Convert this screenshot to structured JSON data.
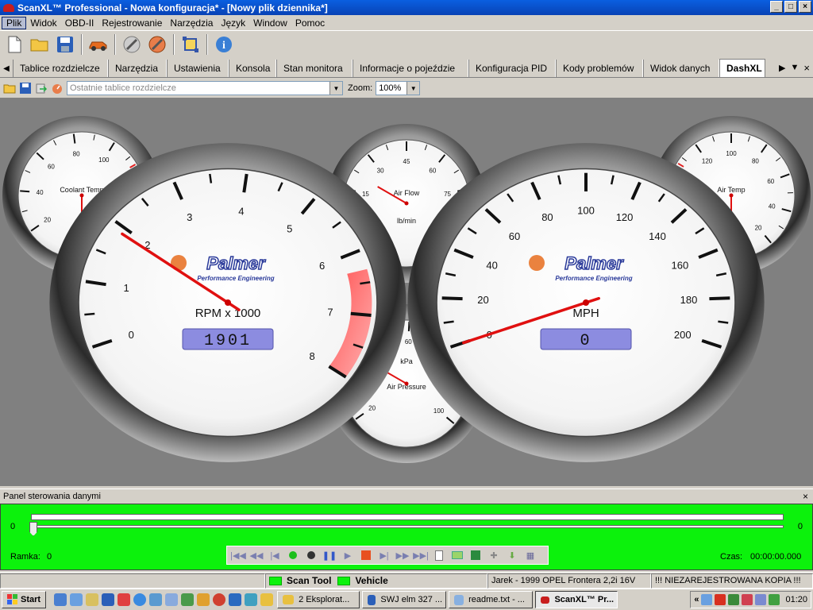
{
  "window": {
    "title": "ScanXL™ Professional - Nowa konfiguracja* - [Nowy plik dziennika*]",
    "minimize": "_",
    "maximize": "□",
    "close": "×"
  },
  "menu": [
    "Plik",
    "Widok",
    "OBD-II",
    "Rejestrowanie",
    "Narzędzia",
    "Język",
    "Window",
    "Pomoc"
  ],
  "tabs": {
    "items": [
      "Tablice rozdzielcze",
      "Narzędzia",
      "Ustawienia",
      "Konsola",
      "Stan monitora",
      "Informacje o pojeździe",
      "Konfiguracja PID",
      "Kody problemów",
      "Widok danych",
      "DashXL"
    ],
    "active_index": 9
  },
  "subtoolbar": {
    "recent_dash_placeholder": "Ostatnie tablice rozdzielcze",
    "zoom_label": "Zoom:",
    "zoom_value": "100%"
  },
  "gauges": {
    "coolant": {
      "label": "Coolant Temp",
      "unit": "°C",
      "ticks": [
        "20",
        "40",
        "60",
        "80",
        "100",
        "120",
        "140"
      ]
    },
    "airflow": {
      "label": "Air Flow",
      "unit": "lb/min",
      "ticks": [
        "0",
        "15",
        "30",
        "45",
        "60",
        "75",
        "90"
      ]
    },
    "airtemp": {
      "label": "Air Temp",
      "unit": "°C",
      "ticks": [
        "140",
        "120",
        "100",
        "80",
        "60",
        "40",
        "20"
      ]
    },
    "rpm": {
      "label": "RPM x 1000",
      "ticks": [
        "0",
        "1",
        "2",
        "3",
        "4",
        "5",
        "6",
        "7",
        "8"
      ],
      "readout": "1901",
      "value": 1.901
    },
    "speed": {
      "label": "MPH",
      "ticks": [
        "0",
        "20",
        "40",
        "60",
        "80",
        "100",
        "120",
        "140",
        "160",
        "180",
        "200"
      ],
      "readout": "0",
      "value": 0
    },
    "pressure": {
      "label": "Air Pressure",
      "unit": "kPa",
      "ticks": [
        "20",
        "40",
        "60",
        "80",
        "100"
      ]
    },
    "brand": "Palmer",
    "brand_sub": "Performance Engineering"
  },
  "panel": {
    "title": "Panel sterowania danymi",
    "left_value": "0",
    "right_value": "0",
    "frame_label": "Ramka:",
    "frame_value": "0",
    "time_label": "Czas:",
    "time_value": "00:00:00.000"
  },
  "status": {
    "scan_tool": "Scan Tool",
    "vehicle": "Vehicle",
    "vehicle_info": "Jarek - 1999 OPEL Frontera 2,2i 16V",
    "unregistered": "!!! NIEZAREJESTROWANA KOPIA !!!"
  },
  "taskbar": {
    "start": "Start",
    "tasks": [
      "2 Eksplorat...",
      "SWJ elm 327 ...",
      "readme.txt - ...",
      "ScanXL™ Pr..."
    ],
    "clock": "01:20"
  }
}
